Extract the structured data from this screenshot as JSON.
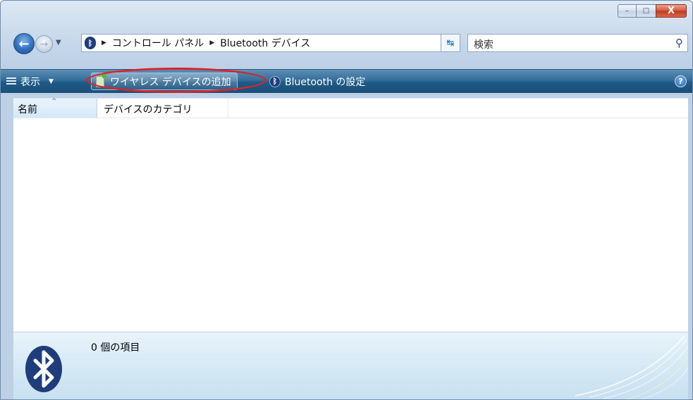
{
  "window": {
    "caption_buttons": {
      "minimize": "–",
      "maximize": "□",
      "close": "X"
    }
  },
  "address_bar": {
    "path": [
      "コントロール パネル",
      "Bluetooth デバイス"
    ],
    "search_placeholder": "検索"
  },
  "command_bar": {
    "views_label": "表示",
    "add_device_label": "ワイヤレス デバイスの追加",
    "settings_label": "Bluetooth の設定",
    "help_label": "?"
  },
  "file_list": {
    "columns": [
      "名前",
      "デバイスのカテゴリ"
    ],
    "sorted_by": "名前",
    "rows": []
  },
  "details_pane": {
    "item_count_text": "0 個の項目"
  },
  "annotation": {
    "highlighted": "ワイヤレス デバイスの追加",
    "color": "#d9252a"
  },
  "colors": {
    "command_bar": "#1e5a85",
    "bluetooth_brand": "#1e3d7a"
  }
}
